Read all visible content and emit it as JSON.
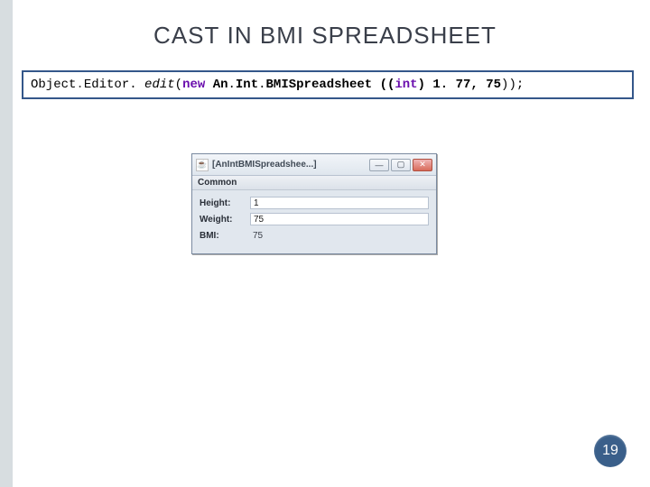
{
  "title": {
    "pre": "C",
    "word1_rest": "AST",
    "mid": " IN ",
    "acronym": "BMI",
    "space": " ",
    "word2_first": "S",
    "word2_rest": "PREADSHEET"
  },
  "code": {
    "t1": "Object",
    "t2": "Editor. ",
    "method": "edit",
    "openParen": "(",
    "kwNew": "new",
    "sp1": " ",
    "cls1": "An",
    "cls2": "Int",
    "cls3": "BMISpreadsheet",
    "sp2": " ",
    "castOpen": "((",
    "kwInt": "int",
    "castClose": ") ",
    "num1": "1. 77",
    "comma": ", ",
    "num2": "75",
    "closeParen": "));"
  },
  "window": {
    "title": "[AnIntBMISpreadshee...]",
    "min": "—",
    "max": "▢",
    "close": "✕",
    "section": "Common",
    "rows": {
      "height": {
        "label": "Height:",
        "value": "1"
      },
      "weight": {
        "label": "Weight:",
        "value": "75"
      },
      "bmi": {
        "label": "BMI:",
        "value": "75"
      }
    },
    "javaGlyph": "☕"
  },
  "pageNumber": "19"
}
